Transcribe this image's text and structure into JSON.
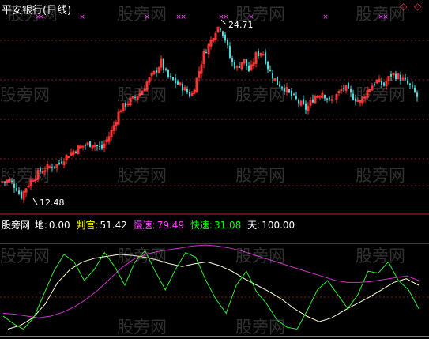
{
  "chart_title": "平安银行(日线)",
  "nav_icons": [
    "diamond-outline",
    "diamond-outline"
  ],
  "watermark_text": "股旁网",
  "price_high_label": "24.71",
  "price_low_label": "12.48",
  "indicator_bar": {
    "name": "股旁网",
    "items": [
      {
        "label": "地:",
        "value": "0.00",
        "color": "#ffffff"
      },
      {
        "label": "判官:",
        "value": "51.42",
        "color": "#ffff00"
      },
      {
        "label": "慢速:",
        "value": "79.49",
        "color": "#ff44ff"
      },
      {
        "label": "快速:",
        "value": "31.08",
        "color": "#00ff00"
      },
      {
        "label": "天:",
        "value": "100.00",
        "color": "#ffffff"
      }
    ]
  },
  "colors": {
    "up": "#ff3333",
    "down": "#44e0e0",
    "grid": "#8a1a1a",
    "divider": "#c02020",
    "marker": "#ff44ff",
    "slow": "#cc33cc",
    "fast": "#33ee33",
    "judge": "#ffffcc",
    "level": "#ffffff"
  },
  "chart_data": [
    {
      "type": "candlestick",
      "title": "平安银行(日线)",
      "ylim": [
        11.5,
        25.5
      ],
      "annotations": [
        {
          "label": "24.71",
          "y": 24.71
        },
        {
          "label": "12.48",
          "y": 12.48
        }
      ]
    },
    {
      "type": "line",
      "ylim": [
        0,
        115
      ],
      "series": [
        {
          "name": "判官",
          "values": [
            8,
            12,
            20,
            35,
            58,
            72,
            80,
            84,
            86,
            88,
            87,
            85,
            82,
            78,
            75,
            78,
            80,
            76,
            70,
            62,
            55,
            48,
            40,
            30,
            22,
            16,
            20,
            28,
            35,
            42,
            50,
            58,
            62,
            55
          ]
        },
        {
          "name": "慢速",
          "values": [
            25,
            24,
            22,
            20,
            22,
            26,
            32,
            40,
            50,
            62,
            74,
            83,
            88,
            91,
            93,
            95,
            97,
            98,
            97,
            95,
            92,
            88,
            84,
            80,
            76,
            72,
            68,
            64,
            60,
            58,
            58,
            59,
            61,
            63,
            65,
            60
          ]
        },
        {
          "name": "快速",
          "values": [
            22,
            14,
            8,
            20,
            45,
            70,
            88,
            80,
            60,
            72,
            90,
            75,
            55,
            80,
            92,
            70,
            50,
            72,
            90,
            85,
            60,
            40,
            25,
            55,
            70,
            48,
            35,
            18,
            10,
            8,
            28,
            50,
            60,
            45,
            30,
            45,
            70,
            68,
            80,
            60,
            50,
            30
          ]
        },
        {
          "name": "地",
          "values": [
            0
          ]
        },
        {
          "name": "天",
          "values": [
            100
          ]
        }
      ]
    }
  ]
}
